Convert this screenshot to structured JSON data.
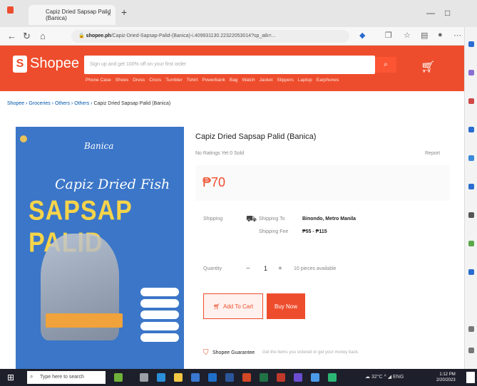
{
  "browser": {
    "tab_title": "Capiz Dried Sapsap Palid (Banica)",
    "url_host": "shopee.ph",
    "url_path": "/Capiz-Dried-Sapsap-Palid-(Banica)-i.409931130.22322053014?sp_atk=...",
    "new_tab": "+",
    "tab_close": "×"
  },
  "shopee": {
    "logo_text": "Shopee",
    "search_placeholder": "Sign up and get 100% off on your first order",
    "hotwords": [
      "Phone Case",
      "Shoes",
      "Dress",
      "Crocs",
      "Tumbler",
      "Tshirt",
      "Powerbank",
      "Bag",
      "Watch",
      "Jacket",
      "Slippers",
      "Laptop",
      "Earphones"
    ]
  },
  "breadcrumb": {
    "items": [
      "Shopee",
      "Groceries",
      "Others",
      "Others"
    ],
    "current": "Capiz Dried Sapsap Palid (Banica)"
  },
  "product_image": {
    "brand": "Banica",
    "title_line1": "Capiz Dried Fish",
    "title_line2": "SAPSAP PALID"
  },
  "product": {
    "title": "Capiz Dried Sapsap Palid (Banica)",
    "meta": "No Ratings Yet   0 Sold",
    "report": "Report",
    "price": "₱70",
    "shipping_label": "Shipping",
    "shipping_to_label": "Shipping To",
    "shipping_to": "Binondo, Metro Manila",
    "shipping_fee_label": "Shipping Fee",
    "shipping_fee": "₱55 - ₱115",
    "quantity_label": "Quantity",
    "quantity": "1",
    "minus": "−",
    "plus": "+",
    "available": "10 pieces available",
    "add_to_cart": "Add To Cart",
    "buy_now": "Buy Now",
    "guarantee_label": "Shopee Guarantee",
    "guarantee_text": "Get the items you ordered or get your money back."
  },
  "taskbar": {
    "search_placeholder": "Type here to search",
    "weather": "32°C",
    "lang": "ENG",
    "time": "1:12 PM",
    "date": "2/20/2023"
  },
  "colors": {
    "brand": "#ee4d2d",
    "image_bg": "#3b76c8",
    "title_yellow": "#f6d44a"
  }
}
